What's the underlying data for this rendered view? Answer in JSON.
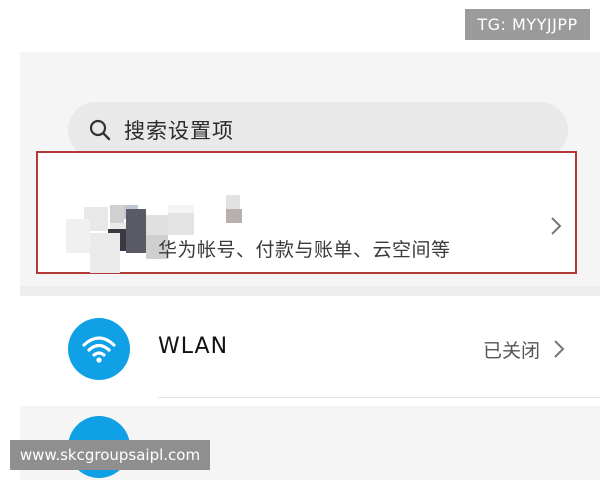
{
  "watermarks": {
    "top_right": "TG: MYYJJPP",
    "bottom_left": "www.skcgroupsaipl.com"
  },
  "search": {
    "placeholder": "搜索设置项",
    "icon": "search-icon"
  },
  "account": {
    "subtitle": "华为帐号、付款与账单、云空间等",
    "avatar": "pixelated-avatar",
    "chevron": "chevron-right-icon",
    "highlight_color": "#b23a36"
  },
  "settings": [
    {
      "label": "WLAN",
      "status": "已关闭",
      "icon": "wifi-icon",
      "icon_color": "#0fa0e6"
    }
  ]
}
